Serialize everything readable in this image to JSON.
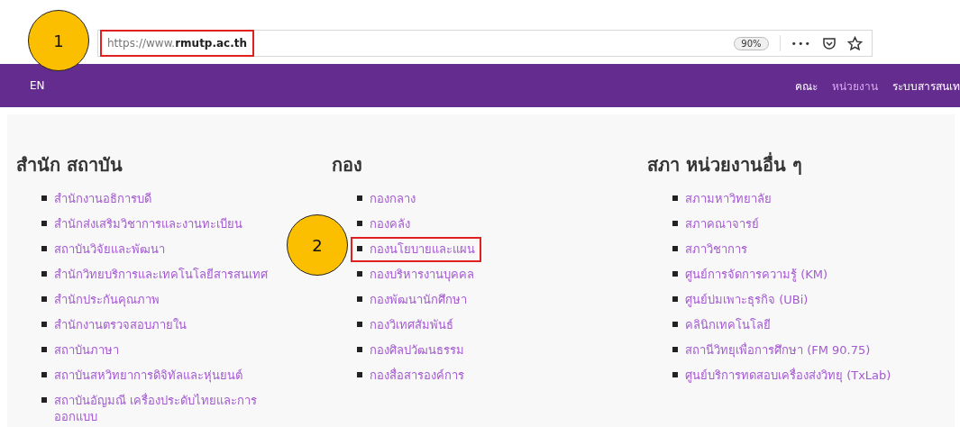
{
  "address_bar": {
    "url": "https://www.**rmutp.ac.th**",
    "highlighted": true,
    "callout": "1",
    "zoom": "90%",
    "more": "•••"
  },
  "nav": {
    "language": "EN",
    "links": [
      {
        "label": "คณะ",
        "selected": false
      },
      {
        "label": "หน่วยงาน",
        "selected": true
      },
      {
        "label": "ระบบสารสนเท",
        "selected": false
      }
    ]
  },
  "sections": [
    {
      "title": "สำนัก สถาบัน",
      "items": [
        {
          "label": "สำนักงานอธิการบดี",
          "highlighted": false
        },
        {
          "label": "สำนักส่งเสริมวิชาการและงานทะเบียน",
          "highlighted": false
        },
        {
          "label": "สถาบันวิจัยและพัฒนา",
          "highlighted": false
        },
        {
          "label": "สำนักวิทยบริการและเทคโนโลยีสารสนเทศ",
          "highlighted": false
        },
        {
          "label": "สำนักประกันคุณภาพ",
          "highlighted": false
        },
        {
          "label": "สำนักงานตรวจสอบภายใน",
          "highlighted": false
        },
        {
          "label": "สถาบันภาษา",
          "highlighted": false
        },
        {
          "label": "สถาบันสหวิทยาการดิจิทัลและหุ่นยนต์",
          "highlighted": false
        },
        {
          "label": "สถาบันอัญมณี เครื่องประดับไทยและการออกแบบ",
          "highlighted": false
        }
      ]
    },
    {
      "title": "กอง",
      "items": [
        {
          "label": "กองกลาง",
          "highlighted": false
        },
        {
          "label": "กองคลัง",
          "highlighted": false
        },
        {
          "label": "กองนโยบายและแผน",
          "highlighted": true,
          "callout": "2"
        },
        {
          "label": "กองบริหารงานบุคคล",
          "highlighted": false
        },
        {
          "label": "กองพัฒนานักศึกษา",
          "highlighted": false
        },
        {
          "label": "กองวิเทศสัมพันธ์",
          "highlighted": false
        },
        {
          "label": "กองศิลปวัฒนธรรม",
          "highlighted": false
        },
        {
          "label": "กองสื่อสารองค์การ",
          "highlighted": false
        }
      ]
    },
    {
      "title": "สภา หน่วยงานอื่น ๆ",
      "items": [
        {
          "label": "สภามหาวิทยาลัย",
          "highlighted": false
        },
        {
          "label": "สภาคณาจารย์",
          "highlighted": false
        },
        {
          "label": "สภาวิชาการ",
          "highlighted": false
        },
        {
          "label": "ศูนย์การจัดการความรู้ (KM)",
          "highlighted": false
        },
        {
          "label": "ศูนย์บ่มเพาะธุรกิจ (UBi)",
          "highlighted": false
        },
        {
          "label": "คลินิกเทคโนโลยี",
          "highlighted": false
        },
        {
          "label": "สถานีวิทยุเพื่อการศึกษา (FM 90.75)",
          "highlighted": false
        },
        {
          "label": "ศูนย์บริการทดสอบเครื่องส่งวิทยุ (TxLab)",
          "highlighted": false
        }
      ]
    }
  ]
}
